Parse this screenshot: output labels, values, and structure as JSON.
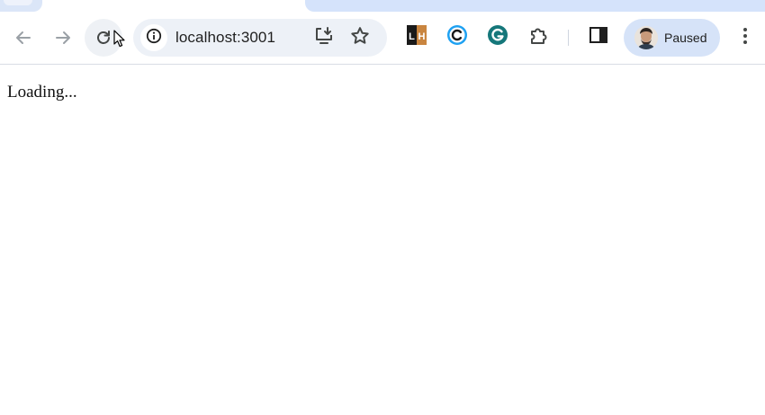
{
  "browser": {
    "url": "localhost:3001",
    "profile_label": "Paused",
    "extensions": [
      {
        "name": "lighthouse-ext",
        "glyphs": "LH"
      },
      {
        "name": "c-ext",
        "glyph": "C"
      },
      {
        "name": "grammarly-ext",
        "glyph": "G"
      }
    ],
    "colors": {
      "tab_active": "#d5e3fb",
      "omnibox_bg": "#edf1f7",
      "profile_bg": "#d6e3f8"
    }
  },
  "page": {
    "status_text": "Loading..."
  }
}
